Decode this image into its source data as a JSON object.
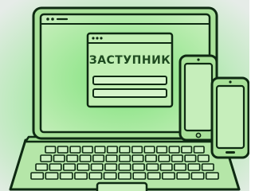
{
  "illustration": {
    "theme": "devices-with-app-window",
    "app_window": {
      "title_text": "ЗАСТУПНИК"
    },
    "devices": [
      "laptop-icon",
      "phone-icon",
      "phone-icon"
    ],
    "colors": {
      "background_outer": "#e4ebe6",
      "glow": "#58d860",
      "stroke": "#0e2a12",
      "screen_fill": "#b3e8a8",
      "window_fill": "#c4f0b6",
      "device_fill": "#a9e29a",
      "keyboard_fill": "#bfe8b3",
      "accent_text": "#1e4a20"
    }
  }
}
